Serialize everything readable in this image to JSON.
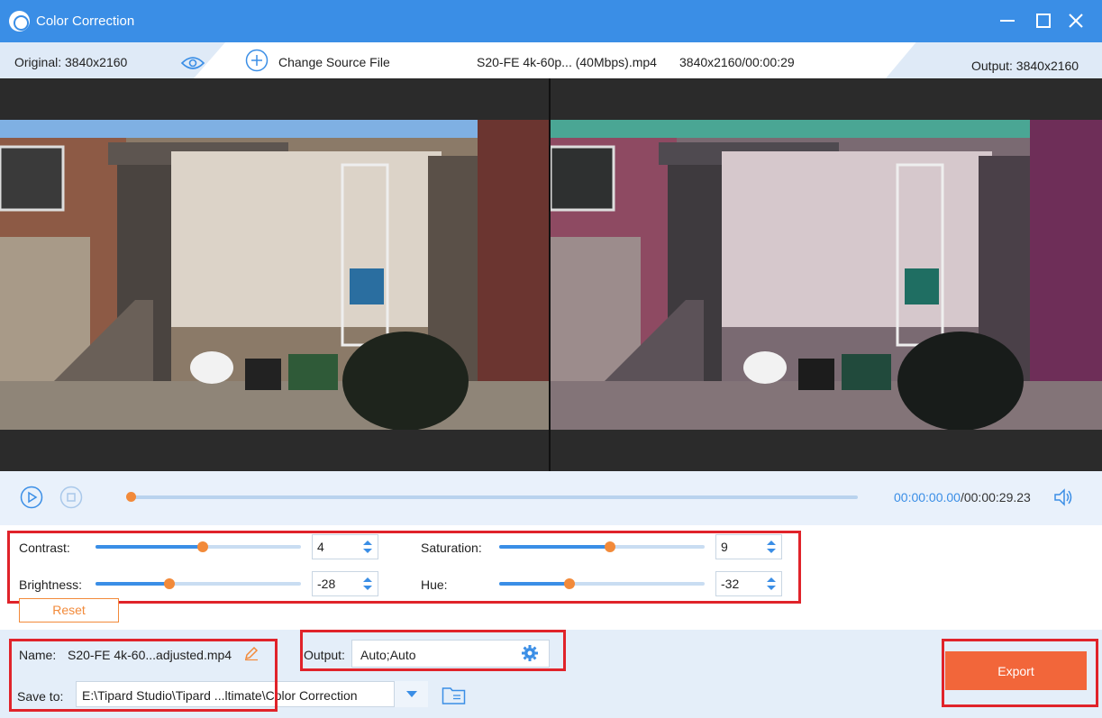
{
  "window": {
    "title": "Color Correction",
    "accent_color": "#3a8ee6",
    "icons": [
      "app-logo-icon",
      "minimize-icon",
      "maximize-icon",
      "close-icon"
    ]
  },
  "info_bar": {
    "original_label": "Original: 3840x2160",
    "change_source_label": "Change Source File",
    "file_name": "S20-FE 4k-60p... (40Mbps).mp4",
    "file_meta": "3840x2160/00:00:29",
    "output_label": "Output: 3840x2160",
    "icons": [
      "eye-icon",
      "plus-circle-icon"
    ]
  },
  "playback": {
    "current_time": "00:00:00.00",
    "total_time": "/00:00:29.23",
    "progress": 0,
    "icons": [
      "play-icon",
      "stop-icon",
      "volume-icon"
    ]
  },
  "adjustments": {
    "contrast": {
      "label": "Contrast:",
      "value": "4",
      "level": 0.52
    },
    "brightness": {
      "label": "Brightness:",
      "value": "-28",
      "level": 0.36
    },
    "saturation": {
      "label": "Saturation:",
      "value": "9",
      "level": 0.54
    },
    "hue": {
      "label": "Hue:",
      "value": "-32",
      "level": 0.34
    },
    "reset_label": "Reset",
    "knob_color": "#f28a3a"
  },
  "export": {
    "name_label": "Name:",
    "name_value": "S20-FE 4k-60...adjusted.mp4",
    "output_label": "Output:",
    "output_value": "Auto;Auto",
    "save_to_label": "Save to:",
    "save_to_value": "E:\\Tipard Studio\\Tipard ...ltimate\\Color Correction",
    "export_label": "Export",
    "export_color": "#f2663a",
    "highlight_color": "#e0232a",
    "icons": [
      "pencil-icon",
      "gear-icon",
      "chevron-down-icon",
      "folder-icon"
    ]
  }
}
